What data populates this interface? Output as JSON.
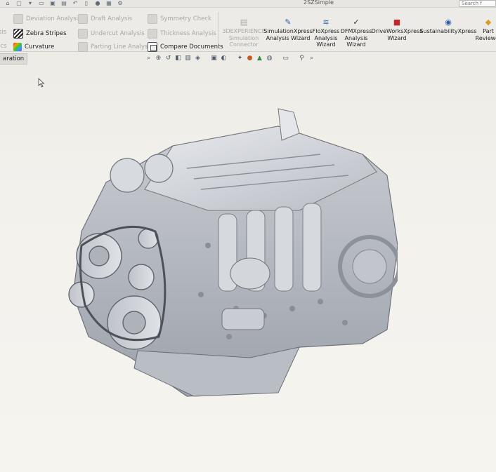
{
  "window": {
    "document_title": "2SZSimple",
    "search_placeholder": "Search f"
  },
  "ribbon": {
    "left_tools": [
      {
        "label": "Deviation Analysis",
        "enabled": false,
        "icon": "deviation-analysis-icon"
      },
      {
        "label": "Zebra Stripes",
        "enabled": true,
        "icon": "zebra-stripes-icon"
      },
      {
        "label": "Curvature",
        "enabled": true,
        "icon": "curvature-icon"
      },
      {
        "label": "Draft Analysis",
        "enabled": false,
        "icon": "draft-analysis-icon"
      },
      {
        "label": "Undercut Analysis",
        "enabled": false,
        "icon": "undercut-analysis-icon"
      },
      {
        "label": "Parting Line Analysis",
        "enabled": false,
        "icon": "parting-line-icon"
      },
      {
        "label": "Symmetry Check",
        "enabled": false,
        "icon": "symmetry-check-icon"
      },
      {
        "label": "Thickness Analysis",
        "enabled": false,
        "icon": "thickness-analysis-icon"
      },
      {
        "label": "Compare Documents",
        "enabled": true,
        "icon": "compare-documents-icon"
      }
    ],
    "left_cut_labels": [
      "sis",
      "ics"
    ],
    "big_tools": [
      {
        "label": "3DEXPERIENCE\nSimulation\nConnector",
        "enabled": false
      },
      {
        "label": "SimulationXpress\nAnalysis Wizard",
        "enabled": true
      },
      {
        "label": "FloXpress\nAnalysis\nWizard",
        "enabled": true
      },
      {
        "label": "DFMXpress\nAnalysis\nWizard",
        "enabled": true
      },
      {
        "label": "DriveWorksXpress\nWizard",
        "enabled": true
      },
      {
        "label": "SustainabilityXpress",
        "enabled": true
      },
      {
        "label": "Part\nReviewer",
        "enabled": true
      }
    ]
  },
  "tabs": {
    "active_label": "aration"
  },
  "colors": {
    "accent_blue": "#2b5fa8",
    "disabled_text": "#a9a8a4"
  }
}
